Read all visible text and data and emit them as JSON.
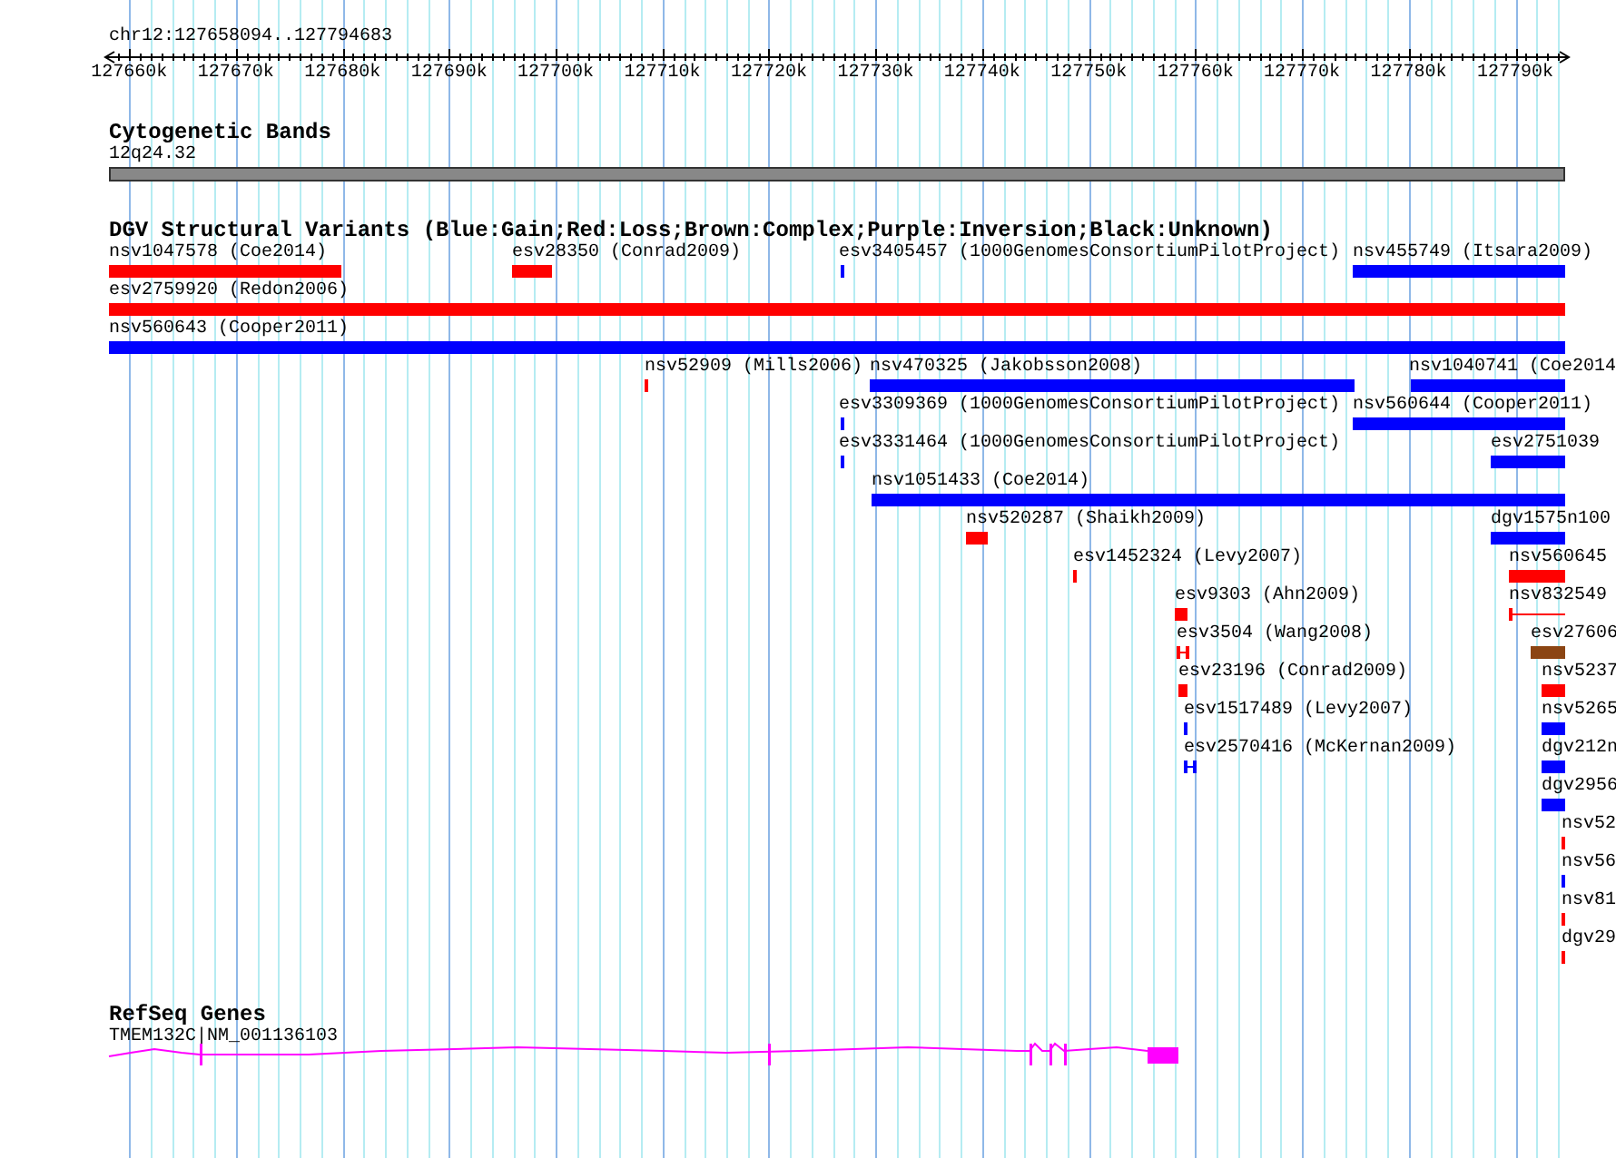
{
  "ruler": {
    "label": "chr12:127658094..127794683",
    "ticks": [
      "127660k",
      "127670k",
      "127680k",
      "127690k",
      "127700k",
      "127710k",
      "127720k",
      "127730k",
      "127740k",
      "127750k",
      "127760k",
      "127770k",
      "127780k",
      "127790k"
    ]
  },
  "cytoband_track": {
    "title": "Cytogenetic Bands",
    "band": "12q24.32"
  },
  "variant_track": {
    "title": "DGV Structural Variants (Blue:Gain;Red:Loss;Brown:Complex;Purple:Inversion;Black:Unknown)",
    "variants": [
      {
        "label": "nsv1047578 (Coe2014)",
        "color": "#ff0000",
        "kind": "block"
      },
      {
        "label": "esv28350 (Conrad2009)",
        "color": "#ff0000",
        "kind": "block"
      },
      {
        "label": "esv3405457 (1000GenomesConsortiumPilotProject)",
        "color": "#0000ff",
        "kind": "block"
      },
      {
        "label": "nsv455749 (Itsara2009)",
        "color": "#0000ff",
        "kind": "block"
      },
      {
        "label": "esv2759920 (Redon2006)",
        "color": "#ff0000",
        "kind": "block"
      },
      {
        "label": "nsv560643 (Cooper2011)",
        "color": "#0000ff",
        "kind": "block"
      },
      {
        "label": "nsv52909 (Mills2006)",
        "color": "#ff0000",
        "kind": "block"
      },
      {
        "label": "nsv470325 (Jakobsson2008)",
        "color": "#0000ff",
        "kind": "block"
      },
      {
        "label": "nsv1040741 (Coe2014",
        "color": "#0000ff",
        "kind": "block"
      },
      {
        "label": "esv3309369 (1000GenomesConsortiumPilotProject)",
        "color": "#0000ff",
        "kind": "block"
      },
      {
        "label": "nsv560644 (Cooper2011)",
        "color": "#0000ff",
        "kind": "block"
      },
      {
        "label": "esv3331464 (1000GenomesConsortiumPilotProject)",
        "color": "#0000ff",
        "kind": "block"
      },
      {
        "label": "esv2751039",
        "color": "#0000ff",
        "kind": "block"
      },
      {
        "label": "nsv1051433 (Coe2014)",
        "color": "#0000ff",
        "kind": "block"
      },
      {
        "label": "nsv520287 (Shaikh2009)",
        "color": "#ff0000",
        "kind": "block"
      },
      {
        "label": "dgv1575n100",
        "color": "#0000ff",
        "kind": "block"
      },
      {
        "label": "esv1452324 (Levy2007)",
        "color": "#ff0000",
        "kind": "block"
      },
      {
        "label": "nsv560645",
        "color": "#ff0000",
        "kind": "block"
      },
      {
        "label": "esv9303 (Ahn2009)",
        "color": "#ff0000",
        "kind": "block"
      },
      {
        "label": "nsv832549",
        "color": "#ff0000",
        "kind": "thin"
      },
      {
        "label": "esv3504 (Wang2008)",
        "color": "#ff0000",
        "kind": "bracket"
      },
      {
        "label": "esv27606",
        "color": "#8b4513",
        "kind": "block"
      },
      {
        "label": "esv23196 (Conrad2009)",
        "color": "#ff0000",
        "kind": "block"
      },
      {
        "label": "nsv5237",
        "color": "#ff0000",
        "kind": "block"
      },
      {
        "label": "esv1517489 (Levy2007)",
        "color": "#0000ff",
        "kind": "block"
      },
      {
        "label": "nsv5265",
        "color": "#0000ff",
        "kind": "block"
      },
      {
        "label": "esv2570416 (McKernan2009)",
        "color": "#0000ff",
        "kind": "bracket"
      },
      {
        "label": "dgv212n",
        "color": "#0000ff",
        "kind": "block"
      },
      {
        "label": "dgv2956",
        "color": "#0000ff",
        "kind": "block"
      },
      {
        "label": "nsv52",
        "color": "#ff0000",
        "kind": "block"
      },
      {
        "label": "nsv56",
        "color": "#0000ff",
        "kind": "block"
      },
      {
        "label": "nsv81",
        "color": "#ff0000",
        "kind": "block"
      },
      {
        "label": "dgv29",
        "color": "#ff0000",
        "kind": "block"
      }
    ]
  },
  "gene_track": {
    "title": "RefSeq Genes",
    "gene": "TMEM132C|NM_001136103"
  }
}
